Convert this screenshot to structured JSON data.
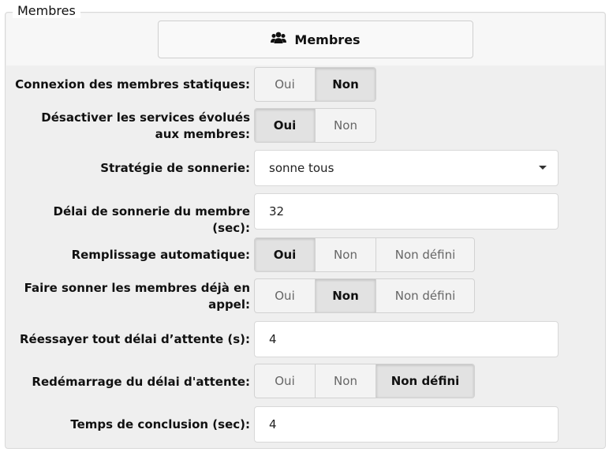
{
  "fieldset": {
    "legend": "Membres"
  },
  "members_button": {
    "label": "Membres",
    "icon": "users-icon"
  },
  "rows": {
    "static_login": {
      "label": "Connexion des membres statiques:",
      "options": [
        "Oui",
        "Non"
      ],
      "selected": "Non"
    },
    "disable_advanced": {
      "label": "Désactiver les services évolués aux membres:",
      "options": [
        "Oui",
        "Non"
      ],
      "selected": "Oui"
    },
    "ring_strategy": {
      "label": "Stratégie de sonnerie:",
      "value": "sonne tous"
    },
    "ring_delay": {
      "label": "Délai de sonnerie du membre (sec):",
      "value": "32"
    },
    "autofill": {
      "label": "Remplissage automatique:",
      "options": [
        "Oui",
        "Non",
        "Non défini"
      ],
      "selected": "Oui"
    },
    "ring_in_use": {
      "label": "Faire sonner les membres déjà en appel:",
      "options": [
        "Oui",
        "Non",
        "Non défini"
      ],
      "selected": "Non"
    },
    "retry": {
      "label": "Réessayer tout délai d’attente (s):",
      "value": "4"
    },
    "timeout_restart": {
      "label": "Redémarrage du délai d'attente:",
      "options": [
        "Oui",
        "Non",
        "Non défini"
      ],
      "selected": "Non défini"
    },
    "wrapup": {
      "label": "Temps de conclusion (sec):",
      "value": "4"
    }
  }
}
